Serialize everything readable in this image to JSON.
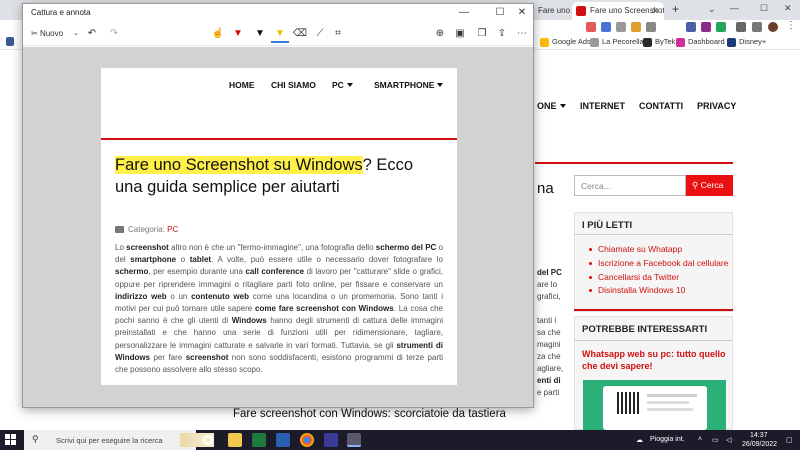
{
  "browser": {
    "tabs": [
      {
        "label": "Fare uno Screenshot su Windows"
      },
      {
        "label": "Fare uno Screenshot su"
      }
    ],
    "new_tab_label": "+",
    "bookmarks": [
      "Google Ads",
      "La Pecorella",
      "ByTek",
      "Dashboard",
      "Disney+"
    ]
  },
  "site": {
    "nav": [
      "ONE",
      "INTERNET",
      "CONTATTI",
      "PRIVACY"
    ],
    "heading_fragment": "na",
    "search_placeholder": "Cerca...",
    "search_button": "Cerca",
    "most_read": {
      "title": "I PIÙ LETTI",
      "links": [
        "Chiamate su Whatapp",
        "Iscrizione a Facebook dal cellulare",
        "Cancellarsi da Twitter",
        "Disinstalla Windows 10"
      ]
    },
    "interest": {
      "title": "POTREBBE INTERESSARTI",
      "link": "Whatsapp web su pc: tutto quello che devi sapere!"
    },
    "text_fragments": [
      "del PC",
      "are lo",
      "grafici,",
      "tanti i",
      "sa che",
      "magini",
      "za che",
      "agliare,",
      "enti di",
      "e parti"
    ],
    "bottom_heading": "Fare screenshot con Windows: scorciatoie da tastiera"
  },
  "snip": {
    "title": "Cattura e annota",
    "new_label": "Nuovo",
    "window_controls": {
      "minimize": "—",
      "maximize": "☐",
      "close": "✕"
    }
  },
  "captured_page": {
    "nav": [
      "HOME",
      "CHI SIAMO",
      "PC",
      "SMARTPHONE"
    ],
    "title_highlight": "Fare uno Screenshot su Windows",
    "title_rest": "? Ecco una guida semplice per aiutarti",
    "category_label": "Categoria:",
    "category_value": "PC",
    "body": [
      {
        "t": "Lo ",
        "b": false
      },
      {
        "t": "screenshot",
        "b": true
      },
      {
        "t": " altro non è che un \"fermo-immagine\", una fotografia dello ",
        "b": false
      },
      {
        "t": "schermo del PC",
        "b": true
      },
      {
        "t": " o del ",
        "b": false
      },
      {
        "t": "smartphone",
        "b": true
      },
      {
        "t": " o ",
        "b": false
      },
      {
        "t": "tablet",
        "b": true
      },
      {
        "t": ". A volte, può essere utile o necessario dover fotografare lo ",
        "b": false
      },
      {
        "t": "schermo",
        "b": true
      },
      {
        "t": ", per esempio durante una ",
        "b": false
      },
      {
        "t": "call conference",
        "b": true
      },
      {
        "t": " di lavoro per \"catturare\" slide o grafici, oppure per riprendere immagini o ritagliare parti foto online, per fissare e conservare un ",
        "b": false
      },
      {
        "t": "indirizzo web",
        "b": true
      },
      {
        "t": " o un ",
        "b": false
      },
      {
        "t": "contenuto web",
        "b": true
      },
      {
        "t": " come una locandina o un promemoria. Sono tanti i motivi per cui può tornare utile sapere ",
        "b": false
      },
      {
        "t": "come fare screenshot con Windows",
        "b": true
      },
      {
        "t": ". La cosa che pochi sanno è che gli utenti di ",
        "b": false
      },
      {
        "t": "Windows",
        "b": true
      },
      {
        "t": " hanno degli strumenti di cattura delle immagini preinstallati e che hanno una serie di funzioni utili per ridimensionare, tagliare, personalizzare le immagini catturate e salvarle in vari formati. Tuttavia, se gli ",
        "b": false
      },
      {
        "t": "strumenti di Windows",
        "b": true
      },
      {
        "t": " per fare ",
        "b": false
      },
      {
        "t": "screenshot",
        "b": true
      },
      {
        "t": " non sono soddisfacenti, esistono programmi di terze parti che possono assolvere allo stesso scopo.",
        "b": false
      }
    ]
  },
  "taskbar": {
    "search_placeholder": "Scrivi qui per eseguire la ricerca",
    "weather": "Pioggia int.",
    "time": "14:37",
    "date": "26/09/2022"
  },
  "colors": {
    "accent_red": "#d01010",
    "highlight": "#fff04a",
    "taskbar": "#1b1b2a"
  }
}
